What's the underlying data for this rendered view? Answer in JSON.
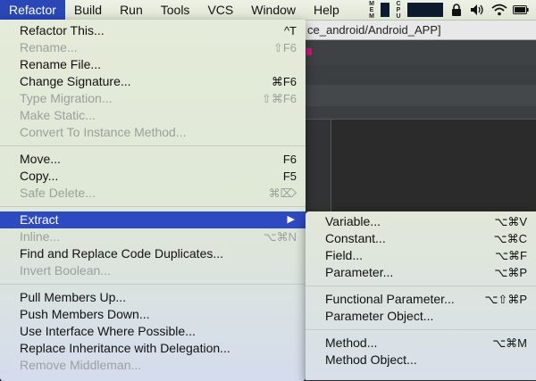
{
  "menubar": {
    "items": [
      "Refactor",
      "Build",
      "Run",
      "Tools",
      "VCS",
      "Window",
      "Help"
    ],
    "meters": [
      "MEM",
      "CPU"
    ]
  },
  "ide": {
    "title": "ce_android/Android_APP]"
  },
  "refactor_menu": {
    "groups": [
      [
        {
          "label": "Refactor This...",
          "shortcut": "^T",
          "disabled": false
        },
        {
          "label": "Rename...",
          "shortcut": "⇧F6",
          "disabled": true
        },
        {
          "label": "Rename File...",
          "shortcut": "",
          "disabled": false
        },
        {
          "label": "Change Signature...",
          "shortcut": "⌘F6",
          "disabled": false
        },
        {
          "label": "Type Migration...",
          "shortcut": "⇧⌘F6",
          "disabled": true
        },
        {
          "label": "Make Static...",
          "shortcut": "",
          "disabled": true
        },
        {
          "label": "Convert To Instance Method...",
          "shortcut": "",
          "disabled": true
        }
      ],
      [
        {
          "label": "Move...",
          "shortcut": "F6",
          "disabled": false
        },
        {
          "label": "Copy...",
          "shortcut": "F5",
          "disabled": false
        },
        {
          "label": "Safe Delete...",
          "shortcut": "⌘⌦",
          "disabled": true
        }
      ],
      [
        {
          "label": "Extract",
          "shortcut": "",
          "disabled": false,
          "highlight": true,
          "submenu": true
        },
        {
          "label": "Inline...",
          "shortcut": "⌥⌘N",
          "disabled": true
        },
        {
          "label": "Find and Replace Code Duplicates...",
          "shortcut": "",
          "disabled": false
        },
        {
          "label": "Invert Boolean...",
          "shortcut": "",
          "disabled": true
        }
      ],
      [
        {
          "label": "Pull Members Up...",
          "shortcut": "",
          "disabled": false
        },
        {
          "label": "Push Members Down...",
          "shortcut": "",
          "disabled": false
        },
        {
          "label": "Use Interface Where Possible...",
          "shortcut": "",
          "disabled": false
        },
        {
          "label": "Replace Inheritance with Delegation...",
          "shortcut": "",
          "disabled": false
        },
        {
          "label": "Remove Middleman...",
          "shortcut": "",
          "disabled": true
        }
      ]
    ]
  },
  "extract_menu": {
    "groups": [
      [
        {
          "label": "Variable...",
          "shortcut": "⌥⌘V"
        },
        {
          "label": "Constant...",
          "shortcut": "⌥⌘C"
        },
        {
          "label": "Field...",
          "shortcut": "⌥⌘F"
        },
        {
          "label": "Parameter...",
          "shortcut": "⌥⌘P"
        }
      ],
      [
        {
          "label": "Functional Parameter...",
          "shortcut": "⌥⇧⌘P"
        },
        {
          "label": "Parameter Object...",
          "shortcut": ""
        }
      ],
      [
        {
          "label": "Method...",
          "shortcut": "⌥⌘M"
        },
        {
          "label": "Method Object...",
          "shortcut": ""
        }
      ]
    ]
  },
  "colors": {
    "highlight": "#2e4ac2",
    "menubar_active": "#2a47b8",
    "ide_background": "#2b2b2b"
  }
}
